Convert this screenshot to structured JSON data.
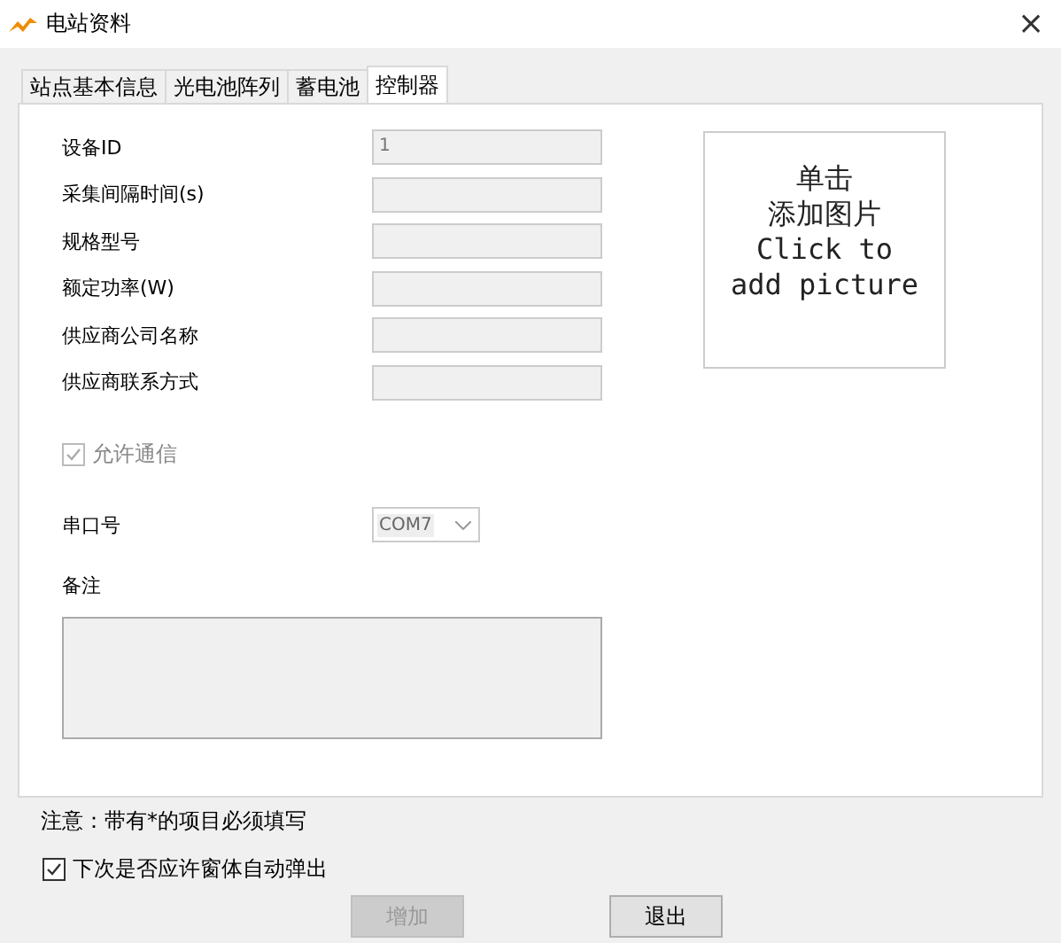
{
  "window": {
    "title": "电站资料",
    "close": "×"
  },
  "tabs": [
    {
      "label": "站点基本信息",
      "selected": false
    },
    {
      "label": "光电池阵列",
      "selected": false
    },
    {
      "label": "蓄电池",
      "selected": false
    },
    {
      "label": "控制器",
      "selected": true
    }
  ],
  "fields": [
    {
      "label": "设备ID",
      "value": "1"
    },
    {
      "label": "采集间隔时间(s)"
    },
    {
      "label": "规格型号"
    },
    {
      "label": "额定功率(W)"
    },
    {
      "label": "供应商公司名称"
    },
    {
      "label": "供应商联系方式"
    }
  ],
  "allow_comm": {
    "label": "允许通信",
    "checked": true,
    "disabled": true
  },
  "port": {
    "label": "串口号",
    "value": "COM7"
  },
  "remarks": {
    "label": "备注"
  },
  "picture_box": {
    "lines": [
      "单击",
      "添加图片",
      "Click to",
      "add picture"
    ]
  },
  "note": "注意：带有*的项目必须填写",
  "auto_popup": {
    "label": "下次是否应许窗体自动弹出",
    "checked": true,
    "disabled": false
  },
  "buttons": [
    {
      "label": "增加",
      "disabled": true
    },
    {
      "label": "退出",
      "disabled": false
    }
  ]
}
